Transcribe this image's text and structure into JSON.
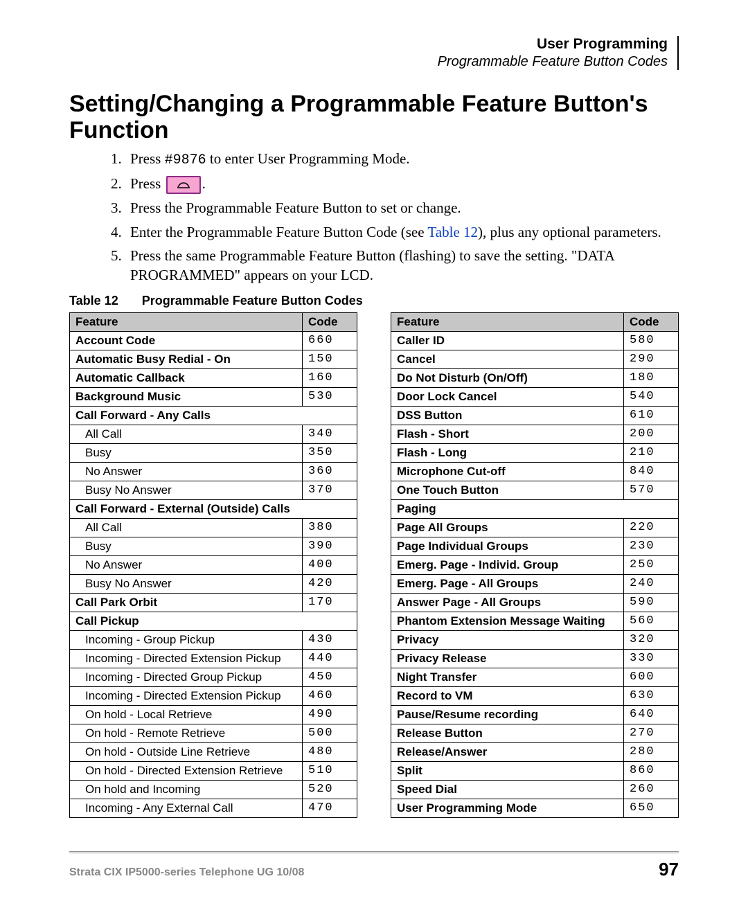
{
  "header": {
    "section": "User Programming",
    "subsection": "Programmable Feature Button Codes"
  },
  "title": "Setting/Changing a Programmable Feature Button's Function",
  "steps": {
    "s1_a": "Press ",
    "s1_code": "#9876",
    "s1_b": " to enter User Programming Mode.",
    "s2_a": "Press ",
    "s2_b": ".",
    "s3": "Press the Programmable Feature Button to set or change.",
    "s4_a": "Enter the Programmable Feature Button Code (see ",
    "s4_link": "Table 12",
    "s4_b": "), plus any optional parameters.",
    "s5": "Press the same Programmable Feature Button (flashing) to save the setting. \"DATA PROGRAMMED\" appears on your LCD."
  },
  "caption": {
    "num": "Table 12",
    "title": "Programmable Feature Button Codes"
  },
  "columns": {
    "feature": "Feature",
    "code": "Code"
  },
  "chart_data": {
    "type": "table",
    "left": [
      {
        "feature": "Account Code",
        "code": "660",
        "bold": true
      },
      {
        "feature": "Automatic Busy Redial - On",
        "code": "150",
        "bold": true
      },
      {
        "feature": "Automatic Callback",
        "code": "160",
        "bold": true
      },
      {
        "feature": "Background Music",
        "code": "530",
        "bold": true
      },
      {
        "feature": "Call Forward - Any Calls",
        "span": true,
        "bold": true
      },
      {
        "feature": "All Call",
        "code": "340",
        "indent": true
      },
      {
        "feature": "Busy",
        "code": "350",
        "indent": true
      },
      {
        "feature": "No Answer",
        "code": "360",
        "indent": true
      },
      {
        "feature": "Busy No Answer",
        "code": "370",
        "indent": true
      },
      {
        "feature": "Call Forward - External (Outside) Calls",
        "span": true,
        "bold": true
      },
      {
        "feature": "All Call",
        "code": "380",
        "indent": true
      },
      {
        "feature": "Busy",
        "code": "390",
        "indent": true
      },
      {
        "feature": "No Answer",
        "code": "400",
        "indent": true
      },
      {
        "feature": "Busy No Answer",
        "code": "420",
        "indent": true
      },
      {
        "feature": "Call Park Orbit",
        "code": "170",
        "bold": true
      },
      {
        "feature": "Call Pickup",
        "span": true,
        "bold": true
      },
      {
        "feature": "Incoming - Group Pickup",
        "code": "430",
        "indent": true
      },
      {
        "feature": "Incoming - Directed Extension Pickup",
        "code": "440",
        "indent": true
      },
      {
        "feature": "Incoming - Directed Group Pickup",
        "code": "450",
        "indent": true
      },
      {
        "feature": "Incoming - Directed Extension Pickup",
        "code": "460",
        "indent": true
      },
      {
        "feature": "On hold - Local Retrieve",
        "code": "490",
        "indent": true
      },
      {
        "feature": "On hold - Remote Retrieve",
        "code": "500",
        "indent": true
      },
      {
        "feature": "On hold - Outside Line Retrieve",
        "code": "480",
        "indent": true
      },
      {
        "feature": "On hold - Directed Extension Retrieve",
        "code": "510",
        "indent": true
      },
      {
        "feature": "On hold and Incoming",
        "code": "520",
        "indent": true
      },
      {
        "feature": "Incoming - Any External Call",
        "code": "470",
        "indent": true
      }
    ],
    "right": [
      {
        "feature": "Caller ID",
        "code": "580",
        "bold": true
      },
      {
        "feature": "Cancel",
        "code": "290",
        "bold": true
      },
      {
        "feature": "Do Not Disturb (On/Off)",
        "code": "180",
        "bold": true
      },
      {
        "feature": "Door Lock Cancel",
        "code": "540",
        "bold": true
      },
      {
        "feature": "DSS Button",
        "code": "610",
        "bold": true
      },
      {
        "feature": "Flash - Short",
        "code": "200",
        "bold": true
      },
      {
        "feature": "Flash - Long",
        "code": "210",
        "bold": true
      },
      {
        "feature": "Microphone Cut-off",
        "code": "840",
        "bold": true
      },
      {
        "feature": "One Touch Button",
        "code": "570",
        "bold": true
      },
      {
        "feature": "Paging",
        "span": true,
        "bold": true
      },
      {
        "feature": "Page All Groups",
        "code": "220",
        "bold": true
      },
      {
        "feature": "Page Individual Groups",
        "code": "230",
        "bold": true
      },
      {
        "feature": "Emerg. Page - Individ. Group",
        "code": "250",
        "bold": true
      },
      {
        "feature": "Emerg. Page - All Groups",
        "code": "240",
        "bold": true
      },
      {
        "feature": "Answer Page - All Groups",
        "code": "590",
        "bold": true
      },
      {
        "feature": "Phantom Extension Message Waiting",
        "code": "560",
        "bold": true
      },
      {
        "feature": "Privacy",
        "code": "320",
        "bold": true
      },
      {
        "feature": "Privacy Release",
        "code": "330",
        "bold": true
      },
      {
        "feature": "Night Transfer",
        "code": "600",
        "bold": true
      },
      {
        "feature": "Record to VM",
        "code": "630",
        "bold": true
      },
      {
        "feature": "Pause/Resume recording",
        "code": "640",
        "bold": true
      },
      {
        "feature": "Release Button",
        "code": "270",
        "bold": true
      },
      {
        "feature": "Release/Answer",
        "code": "280",
        "bold": true
      },
      {
        "feature": "Split",
        "code": "860",
        "bold": true
      },
      {
        "feature": "Speed Dial",
        "code": "260",
        "bold": true
      },
      {
        "feature": "User Programming Mode",
        "code": "650",
        "bold": true
      }
    ]
  },
  "footer": {
    "left": "Strata CIX IP5000-series Telephone UG    10/08",
    "page": "97"
  }
}
